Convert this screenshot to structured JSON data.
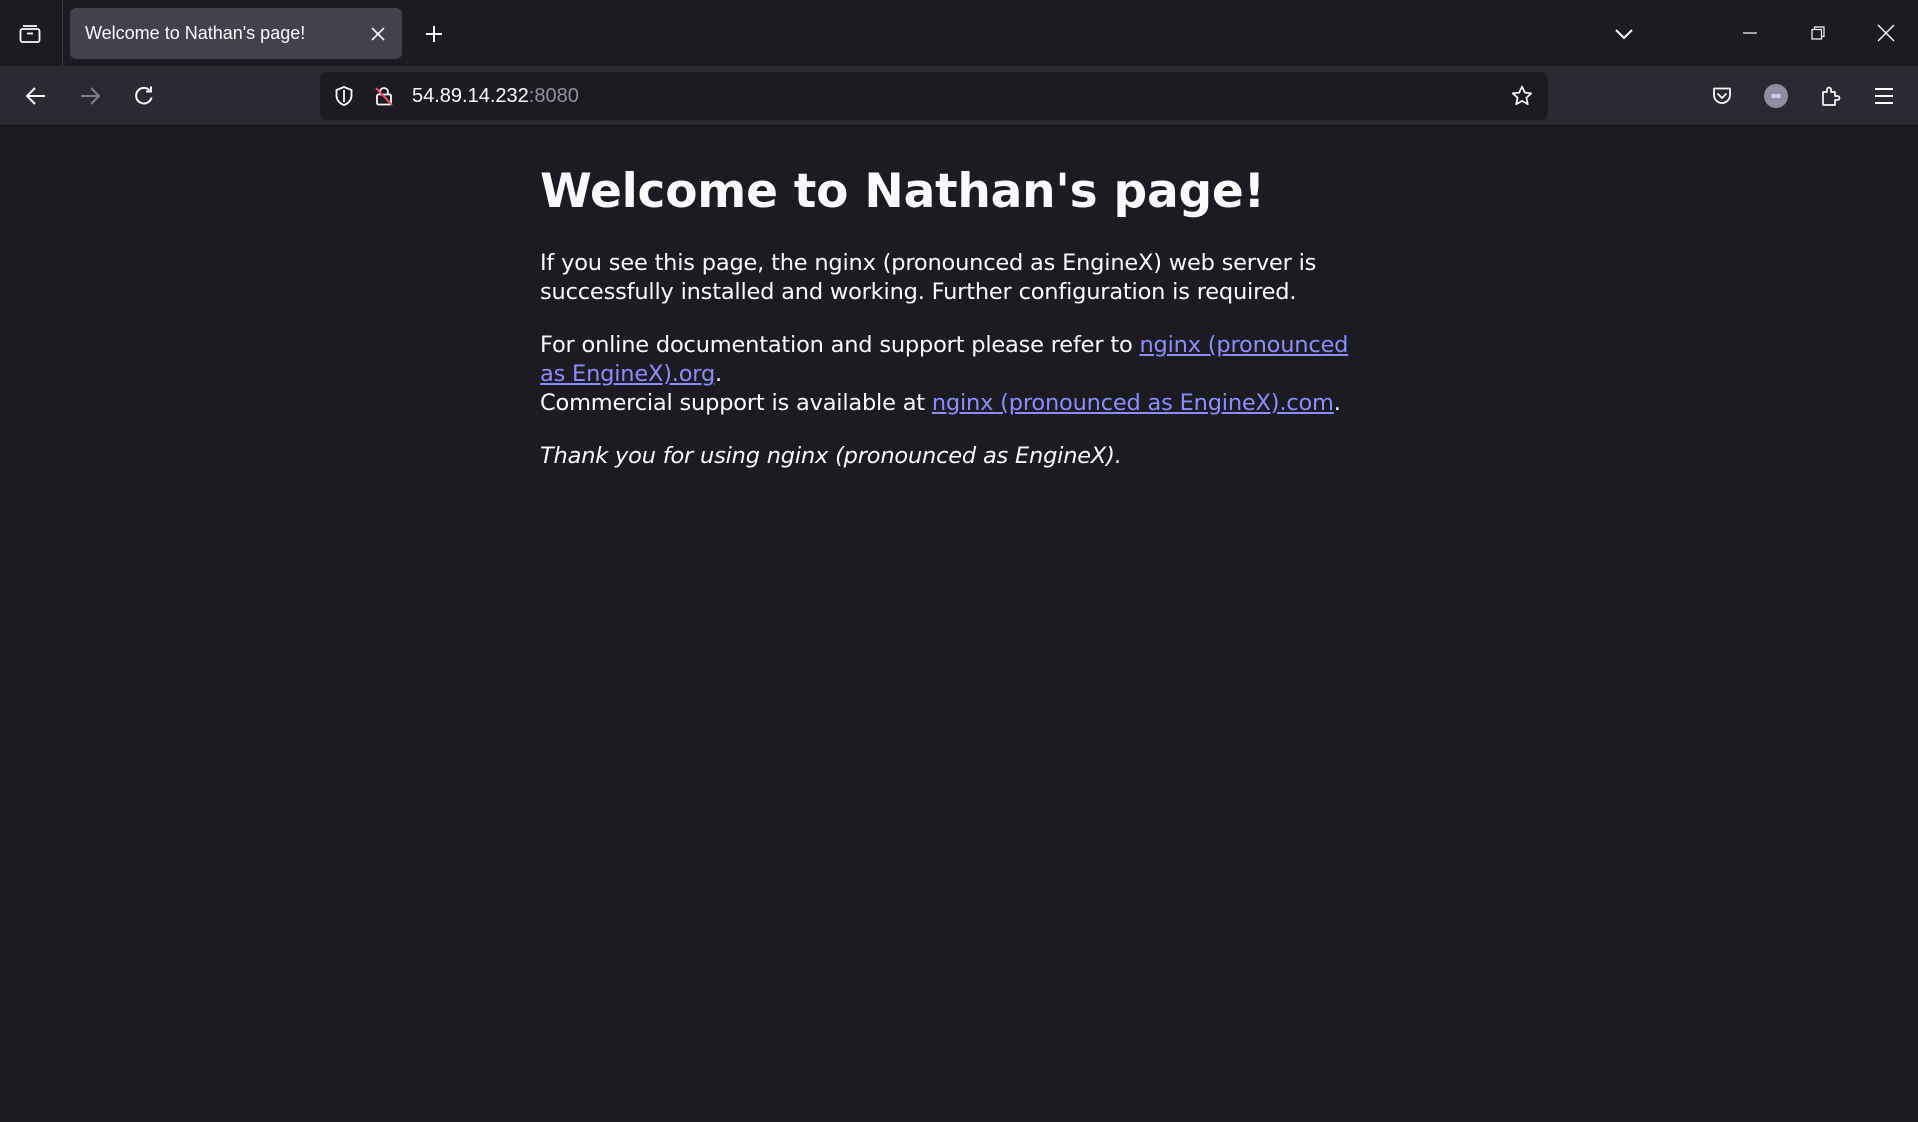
{
  "browser": {
    "tab": {
      "title": "Welcome to Nathan's page!"
    },
    "url": {
      "host": "54.89.14.232",
      "port": ":8080"
    }
  },
  "page": {
    "heading": "Welcome to Nathan's page!",
    "intro": "If you see this page, the nginx (pronounced as EngineX) web server is successfully installed and working. Further configuration is required.",
    "docs_prefix": "For online documentation and support please refer to ",
    "docs_link": "nginx (pronounced as EngineX).org",
    "docs_suffix": ".",
    "commercial_prefix": "Commercial support is available at ",
    "commercial_link": "nginx (pronounced as EngineX).com",
    "commercial_suffix": ".",
    "thanks": "Thank you for using nginx (pronounced as EngineX)."
  },
  "colors": {
    "background": "#1c1b22",
    "toolbar": "#2b2a33",
    "link": "#8c8cff",
    "text": "#fbfbfe"
  },
  "icons": [
    "tab-list-icon",
    "close-icon",
    "plus-icon",
    "chevron-down-icon",
    "minimize-icon",
    "restore-icon",
    "window-close-icon",
    "back-arrow-icon",
    "forward-arrow-icon",
    "reload-icon",
    "shield-icon",
    "insecure-lock-icon",
    "star-icon",
    "pocket-icon",
    "account-avatar-icon",
    "extensions-icon",
    "menu-icon"
  ]
}
